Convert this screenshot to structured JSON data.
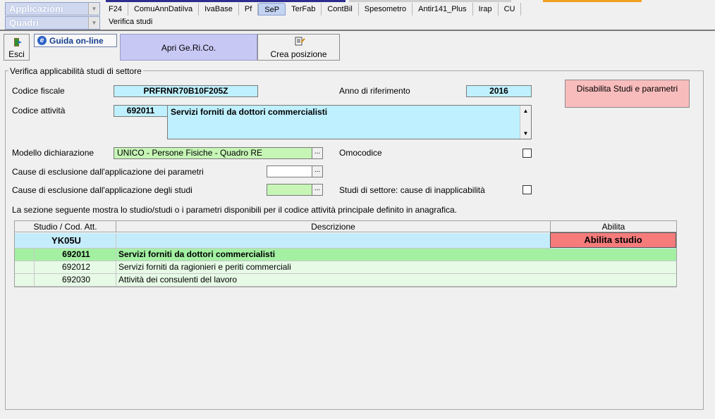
{
  "header": {
    "app_combo": "Applicazioni",
    "section_combo": "Quadri",
    "tabs": [
      "F24",
      "ComuAnnDatiIva",
      "IvaBase",
      "Pf",
      "SeP",
      "TerFab",
      "ContBil",
      "Spesometro",
      "Antir141_Plus",
      "Irap",
      "CU"
    ],
    "active_tab": "SeP",
    "subtitle": "Verifica studi"
  },
  "toolbar": {
    "exit_label": "Esci",
    "guide_label": "Guida on-line",
    "gerico_label": "Apri Ge.Ri.Co.",
    "crea_label": "Crea posizione"
  },
  "form": {
    "group_title": "Verifica applicabilità studi di settore",
    "codice_fiscale_label": "Codice fiscale",
    "codice_fiscale_value": "PRFRNR70B10F205Z",
    "anno_label": "Anno di riferimento",
    "anno_value": "2016",
    "disable_button": "Disabilita Studi e parametri",
    "codice_attivita_label": "Codice attività",
    "codice_attivita_value": "692011",
    "descrizione_attivita": "Servizi forniti da dottori commercialisti",
    "modello_label": "Modello dichiarazione",
    "modello_value": "UNICO - Persone Fisiche - Quadro RE",
    "omocodice_label": "Omocodice",
    "cause_parametri_label": "Cause di esclusione dall'applicazione dei parametri",
    "cause_studi_label": "Cause di esclusione dall'applicazione degli studi",
    "inapplicabilita_label": "Studi di settore: cause di inapplicabilità",
    "ellipsis": "...",
    "info_text": "La sezione seguente mostra lo studio/studi o i parametri disponibili per il codice attività principale definito in anagrafica."
  },
  "table": {
    "headers": [
      "Studio / Cod. Att.",
      "Descrizione",
      "Abilita"
    ],
    "studio": "YK05U",
    "abilita_button": "Abilita studio",
    "rows": [
      {
        "code": "692011",
        "desc": "Servizi forniti da dottori commercialisti"
      },
      {
        "code": "692012",
        "desc": "Servizi forniti da ragionieri e periti commerciali"
      },
      {
        "code": "692030",
        "desc": "Attività dei consulenti del lavoro"
      }
    ]
  },
  "colors": {
    "field_cyan": "#bff0ff",
    "field_green": "#c6f5b6",
    "row_green": "#a3f0a3",
    "row_light": "#e6fae6",
    "abilita_red": "#f67c7c",
    "disable_pink": "#f9bcbc",
    "gerico_lilac": "#c8c8f5"
  }
}
